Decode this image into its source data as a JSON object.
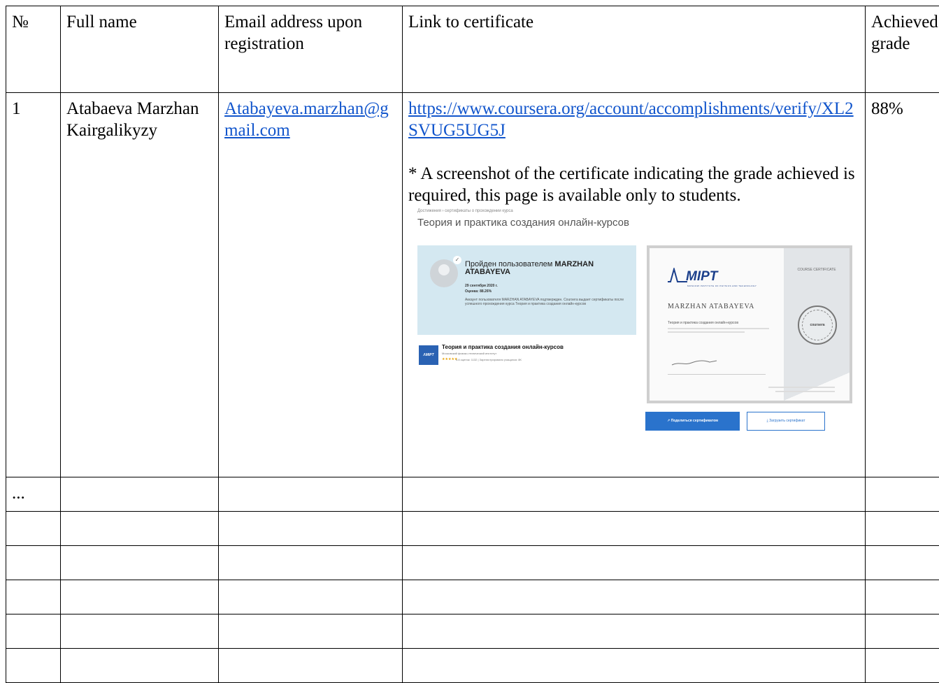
{
  "table": {
    "headers": {
      "number": "№",
      "full_name": "Full name",
      "email": "Email address upon registration",
      "link": "Link to certificate",
      "grade": "Achieved grade"
    },
    "row1": {
      "number": "1",
      "full_name": "Atabaeva Marzhan Kairgalikyzy",
      "email": "Atabayeva.marzhan@gmail.com",
      "link": "https://www.coursera.org/account/accomplishments/verify/XL2SVUG5UG5J",
      "note": "* A screenshot of the certificate indicating the grade achieved is required, this page is available only to students.",
      "grade": "88%"
    },
    "row_ellipsis": "..."
  },
  "certificate_screenshot": {
    "breadcrumb": "Достижения › сертификаты о прохождении курса",
    "course_title": "Теория и практика создания онлайн-курсов",
    "passed_prefix": "Пройден пользователем",
    "user_name": "MARZHAN ATABAYEVA",
    "date": "29 сентября 2020 г.",
    "grade_line": "Оценка: 88.26%",
    "description": "Аккаунт пользователя MARZHAN ATABAYEVA подтвержден. Coursera выдает сертификаты после успешного прохождения курса Теория и практика создания онлайн-курсов",
    "course_card_name": "Теория и практика создания онлайн-курсов",
    "course_card_university": "Московский физико-технический институт",
    "course_card_stars": "★★★★★",
    "course_card_meta": "4.8 оценок: 1132 | Зарегистрировано учащихся: 8K",
    "cert_logo": "МIPT",
    "cert_logo_sub": "MOSCOW INSTITUTE OF PHYSICS AND TECHNOLOGY",
    "cert_type": "COURSE CERTIFICATE",
    "cert_name": "MARZHAN ATABAYEVA",
    "cert_course": "Теория и практика создания онлайн-курсов",
    "seal_text": "coursera",
    "share_button": "Поделиться сертификатом",
    "download_button": "Загрузить сертификат"
  }
}
